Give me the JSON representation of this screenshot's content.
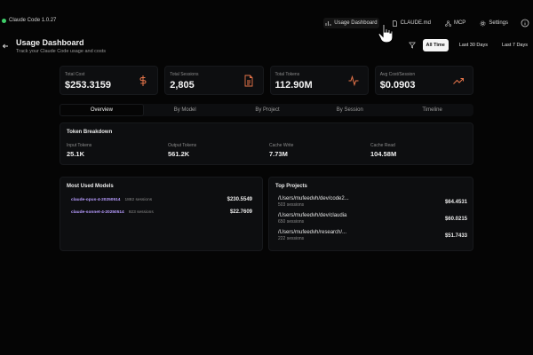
{
  "app": {
    "title": "Claude Code 1.0.27",
    "status_color": "#3fcf6a"
  },
  "nav": {
    "items": [
      {
        "label": "Usage Dashboard",
        "icon": "bar-chart-icon"
      },
      {
        "label": "CLAUDE.md",
        "icon": "file-icon"
      },
      {
        "label": "MCP",
        "icon": "network-icon"
      },
      {
        "label": "Settings",
        "icon": "gear-icon"
      }
    ]
  },
  "header": {
    "title": "Usage Dashboard",
    "subtitle": "Track your Claude Code usage and costs"
  },
  "filters": {
    "options": [
      "All Time",
      "Last 30 Days",
      "Last 7 Days"
    ],
    "selected": "All Time"
  },
  "stats": [
    {
      "label": "Total Cost",
      "value": "$253.3159",
      "icon": "dollar-icon"
    },
    {
      "label": "Total Sessions",
      "value": "2,805",
      "icon": "document-icon"
    },
    {
      "label": "Total Tokens",
      "value": "112.90M",
      "icon": "activity-icon"
    },
    {
      "label": "Avg Cost/Session",
      "value": "$0.0903",
      "icon": "trending-up-icon"
    }
  ],
  "tabs": [
    "Overview",
    "By Model",
    "By Project",
    "By Session",
    "Timeline"
  ],
  "active_tab": "Overview",
  "token_breakdown": {
    "title": "Token Breakdown",
    "items": [
      {
        "label": "Input Tokens",
        "value": "25.1K"
      },
      {
        "label": "Output Tokens",
        "value": "561.2K"
      },
      {
        "label": "Cache Write",
        "value": "7.73M"
      },
      {
        "label": "Cache Read",
        "value": "104.58M"
      }
    ]
  },
  "models": {
    "title": "Most Used Models",
    "items": [
      {
        "name": "claude-opus-4-20250514",
        "sessions": "1882 sessions",
        "cost": "$230.5549"
      },
      {
        "name": "claude-sonnet-4-20250514",
        "sessions": "923 sessions",
        "cost": "$22.7609"
      }
    ]
  },
  "projects": {
    "title": "Top Projects",
    "items": [
      {
        "name": "/Users/mufeedvh/dev/code2...",
        "sessions": "503 sessions",
        "cost": "$64.4531"
      },
      {
        "name": "/Users/mufeedvh/dev/claudia",
        "sessions": "650 sessions",
        "cost": "$60.0215"
      },
      {
        "name": "/Users/mufeedvh/research/...",
        "sessions": "222 sessions",
        "cost": "$51.7433"
      }
    ]
  },
  "colors": {
    "accent_orange": "#e8754a",
    "model_purple": "#b79cff",
    "background": "#050505"
  }
}
